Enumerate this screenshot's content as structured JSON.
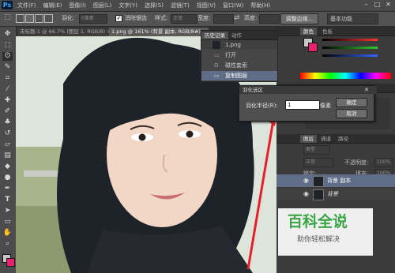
{
  "app": {
    "logo": "Ps"
  },
  "menu": {
    "items": [
      "文件(F)",
      "编辑(E)",
      "图像(I)",
      "图层(L)",
      "文字(Y)",
      "选择(S)",
      "滤镜(T)",
      "视图(V)",
      "窗口(W)",
      "帮助(H)"
    ]
  },
  "window_controls": {
    "minimize": "–",
    "maximize": "□",
    "close": "✕"
  },
  "options_bar": {
    "feather_label": "羽化:",
    "feather_value": "0像素",
    "antialias_label": "消除锯齿",
    "style_label": "样式:",
    "style_value": "正常",
    "width_label": "宽度:",
    "height_label": "高度:",
    "refine_label": "调整边缘...",
    "workspace_label": "基本功能"
  },
  "tabs": [
    {
      "label": "未标题-1 @ 66.7% (图层 1, RGB/8) ×",
      "active": false
    },
    {
      "label": "1.png @ 161% (背景 副本, RGB/8#) ×",
      "active": true
    }
  ],
  "history_panel": {
    "tabs": [
      "历史记录",
      "动作"
    ],
    "snapshot": "1.png",
    "items": [
      "打开",
      "磁性套索",
      "复制图层"
    ]
  },
  "color_panel": {
    "tabs": [
      "颜色",
      "色板"
    ],
    "accent": "#e8206e"
  },
  "layers_panel": {
    "tabs": [
      "图层",
      "通道",
      "路径"
    ],
    "kind_label": "类型",
    "blend_mode": "正常",
    "opacity_label": "不透明度:",
    "opacity_value": "100%",
    "lock_label": "锁定:",
    "fill_label": "填充:",
    "fill_value": "100%",
    "layers": [
      {
        "name": "背景 副本",
        "selected": true
      },
      {
        "name": "背景",
        "selected": false
      }
    ]
  },
  "feather_dialog": {
    "title": "羽化选区",
    "radius_label": "羽化半径(R):",
    "radius_value": "1",
    "unit": "像素",
    "ok_label": "确定",
    "cancel_label": "取消"
  },
  "watermark": {
    "title": "百科全说",
    "subtitle": "助你轻松解决"
  }
}
